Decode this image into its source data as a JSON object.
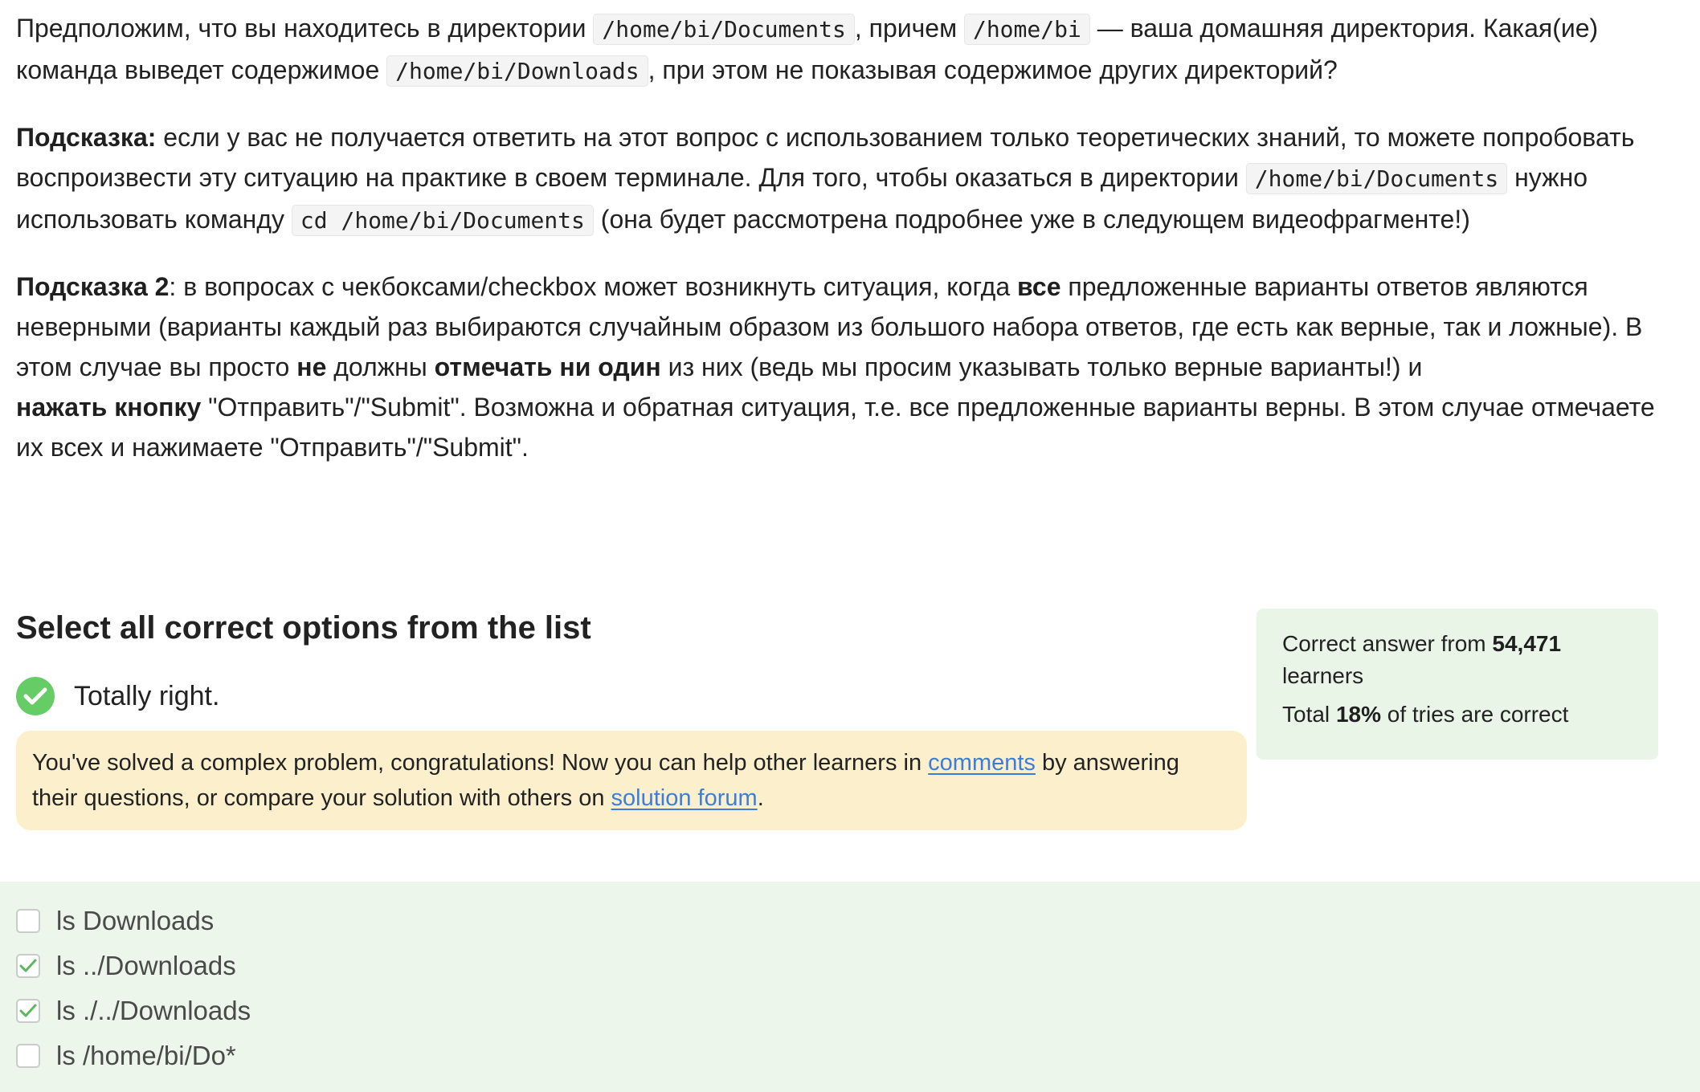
{
  "question": {
    "p1": {
      "t1": "Предположим, что вы находитесь в директории ",
      "c1": "/home/bi/Documents",
      "t2": ", причем ",
      "c2": "/home/bi",
      "t3": " — ваша домашняя директория. Какая(ие) команда выведет содержимое ",
      "c3": "/home/bi/Downloads",
      "t4": ", при этом не показывая содержимое других директорий?"
    },
    "p2": {
      "b1": "Подсказка:",
      "t1": " если у вас не получается ответить на этот вопрос с использованием только теоретических знаний, то можете попробовать воспроизвести эту ситуацию на практике в своем терминале. Для того, чтобы оказаться в директории ",
      "c1": "/home/bi/Documents",
      "t2": " нужно использовать команду ",
      "c2": "cd /home/bi/Documents",
      "t3": " (она будет рассмотрена подробнее уже в следующем видеофрагменте!)"
    },
    "p3": {
      "b1": "Подсказка 2",
      "t1": ": в вопросах с чекбоксами/checkbox может возникнуть ситуация, когда ",
      "b2": "все",
      "t2": " предложенные варианты ответов являются неверными (варианты каждый раз выбираются случайным образом из большого набора ответов, где есть как верные, так и ложные). В этом случае вы просто ",
      "b3": "не",
      "t3": " должны ",
      "b4": "отмечать ни один",
      "t4": " из них (ведь мы просим указывать только верные варианты!) и ",
      "b5": "нажать кнопку",
      "t5": " \"Отправить\"/\"Submit\". Возможна и обратная ситуация, т.е. все предложенные варианты верны. В этом случае отмечаете их всех и нажимаете \"Отправить\"/\"Submit\"."
    }
  },
  "task": {
    "title": "Select all correct options from the list",
    "status": "Totally right."
  },
  "congrats": {
    "t1": "You've solved a complex problem, congratulations! Now you can help other learners in ",
    "link1": "comments",
    "t2": " by answering their questions, or compare your solution with others on ",
    "link2": "solution forum",
    "t3": "."
  },
  "stats": {
    "t1": "Correct answer from ",
    "count": "54,471",
    "t2": " learners",
    "t3": "Total ",
    "percent": "18%",
    "t4": " of tries are correct"
  },
  "options": [
    {
      "label": "ls Downloads",
      "checked": false
    },
    {
      "label": "ls ../Downloads",
      "checked": true
    },
    {
      "label": "ls ./../Downloads",
      "checked": true
    },
    {
      "label": "ls /home/bi/Do*",
      "checked": false
    }
  ],
  "colors": {
    "success": "#66cc66",
    "link": "#3b7ddd",
    "congrats_bg": "#fcf0cc",
    "stats_bg": "#e9f5e7",
    "options_bg": "#ecf6ea"
  }
}
